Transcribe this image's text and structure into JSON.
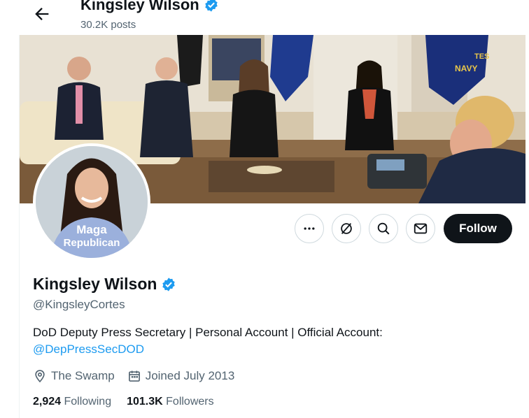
{
  "header": {
    "back_icon": "arrow-left-icon",
    "name": "Kingsley Wilson",
    "posts": "30.2K posts"
  },
  "profile": {
    "name": "Kingsley Wilson",
    "verified_icon": "verified-badge-icon",
    "handle": "@KingsleyCortes",
    "bio_text": "DoD Deputy Press Secretary | Personal Account | Official Account:",
    "bio_link": "@DepPressSecDOD",
    "location": "The Swamp",
    "joined": "Joined July 2013",
    "following_count": "2,924",
    "following_label": "Following",
    "followers_count": "101.3K",
    "followers_label": "Followers",
    "avatar_shirt_line1": "Maga",
    "avatar_shirt_line2": "Republican"
  },
  "actions": {
    "more_icon": "more-icon",
    "grok_icon": "grok-icon",
    "search_icon": "search-icon",
    "message_icon": "message-icon",
    "follow_label": "Follow"
  },
  "banner": {
    "flag_text": "NAVY",
    "flag_text2": "TES"
  },
  "colors": {
    "accent": "#1d9bf0",
    "text": "#0f1419",
    "secondary": "#536471",
    "follow_bg": "#0f1419"
  }
}
